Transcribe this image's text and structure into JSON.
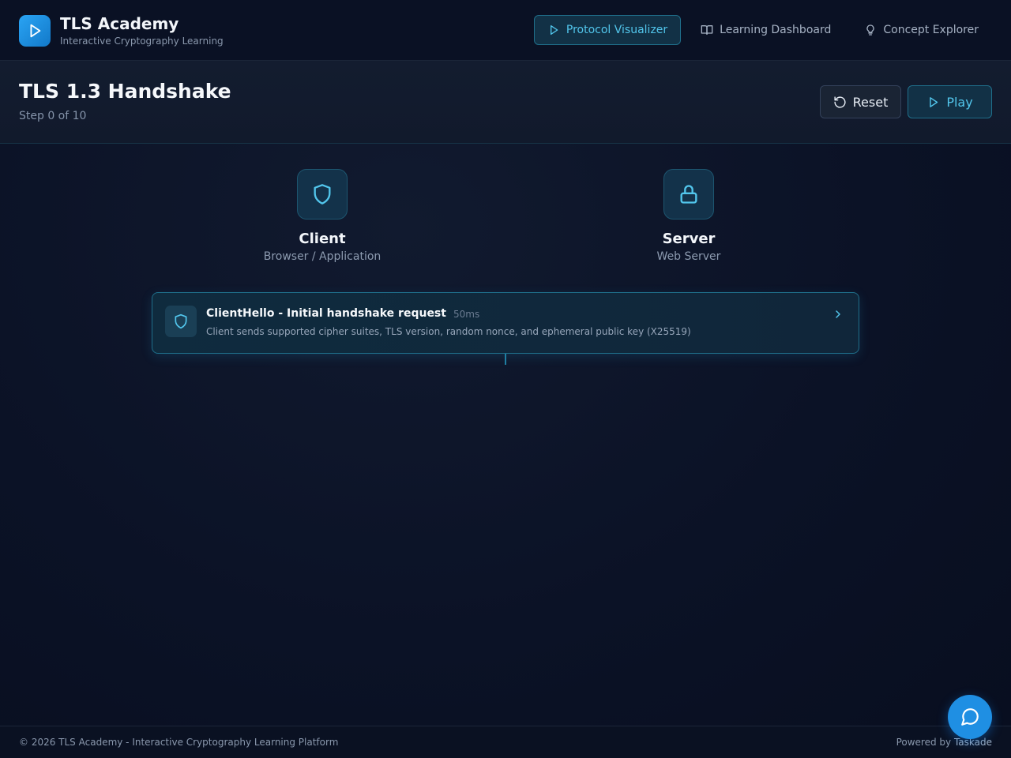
{
  "app": {
    "title": "TLS Academy",
    "subtitle": "Interactive Cryptography Learning",
    "logo_icon": "play-icon"
  },
  "nav": {
    "items": [
      {
        "label": "Protocol Visualizer",
        "icon": "play-icon",
        "active": true
      },
      {
        "label": "Learning Dashboard",
        "icon": "book-open-icon",
        "active": false
      },
      {
        "label": "Concept Explorer",
        "icon": "lightbulb-icon",
        "active": false
      }
    ]
  },
  "header": {
    "title": "TLS 1.3 Handshake",
    "step": "Step 0 of 10",
    "reset_label": "Reset",
    "play_label": "Play"
  },
  "actors": {
    "client": {
      "name": "Client",
      "role": "Browser / Application",
      "icon": "shield-icon"
    },
    "server": {
      "name": "Server",
      "role": "Web Server",
      "icon": "lock-icon"
    }
  },
  "message": {
    "title": "ClientHello - Initial handshake request",
    "time": "50ms",
    "description": "Client sends supported cipher suites, TLS version, random nonce, and ephemeral public key (X25519)",
    "icon": "shield-icon"
  },
  "footer": {
    "copyright": "© 2026 TLS Academy - Interactive Cryptography Learning Platform",
    "powered_prefix": "Powered by ",
    "powered_brand": "Taskade"
  },
  "colors": {
    "accent": "#52c6ec",
    "brand_blue": "#1f8fe3",
    "background": "#0b1224"
  }
}
